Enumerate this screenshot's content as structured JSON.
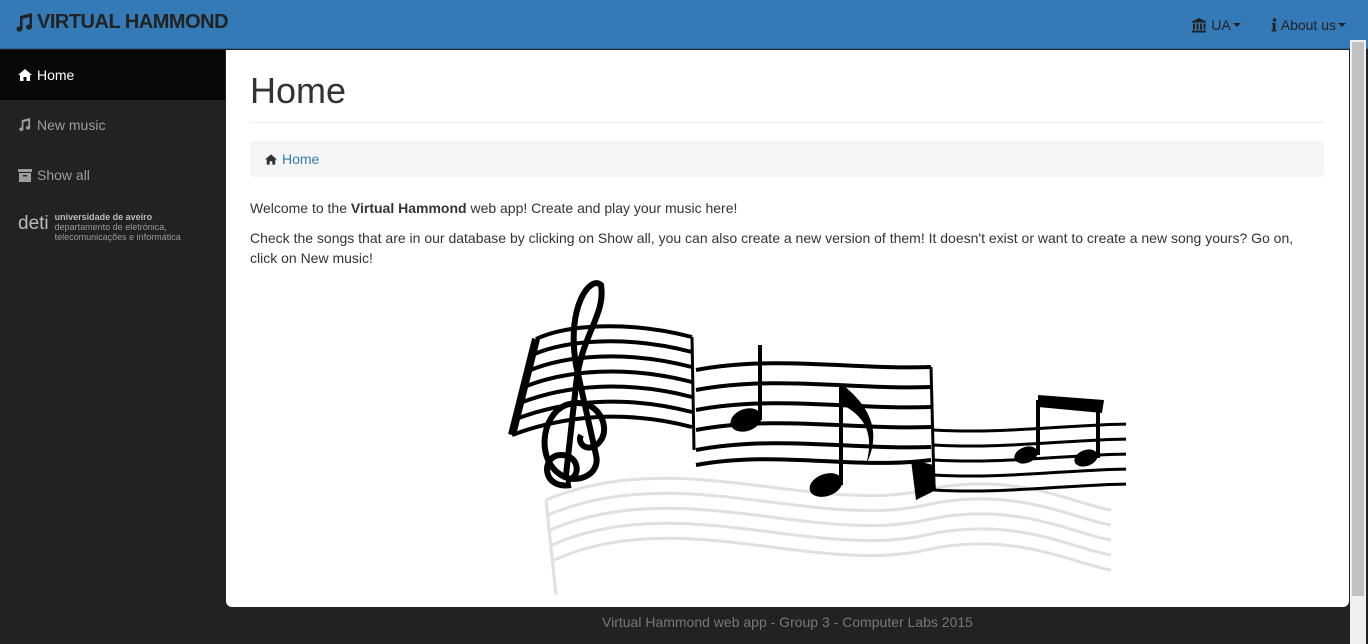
{
  "brand": {
    "title": "VIRTUAL HAMMOND",
    "icon": "music-note-icon"
  },
  "topnav": [
    {
      "label": "UA",
      "icon": "institution-icon"
    },
    {
      "label": "About us",
      "icon": "info-icon"
    }
  ],
  "sidebar": {
    "items": [
      {
        "label": "Home",
        "icon": "home-icon",
        "active": true
      },
      {
        "label": "New music",
        "icon": "music-icon",
        "active": false
      },
      {
        "label": "Show all",
        "icon": "archive-icon",
        "active": false
      }
    ],
    "logo": {
      "word": "deti",
      "line1": "universidade de aveiro",
      "line2": "departamento de eletrónica,",
      "line3": "telecomunicações e informática"
    }
  },
  "main": {
    "title": "Home",
    "breadcrumb": "Home",
    "intro_pre": "Welcome to the ",
    "intro_bold": "Virtual Hammond",
    "intro_post": " web app! Create and play your music here!",
    "paragraph": "Check the songs that are in our database by clicking on Show all, you can also create a new version of them! It doesn't exist or want to create a new song yours? Go on, click on New music!"
  },
  "footer": "Virtual Hammond web app - Group 3 - Computer Labs 2015",
  "colors": {
    "navbar": "#337ab7",
    "sidebar": "#222222",
    "active": "#080808",
    "link": "#337ab7"
  }
}
